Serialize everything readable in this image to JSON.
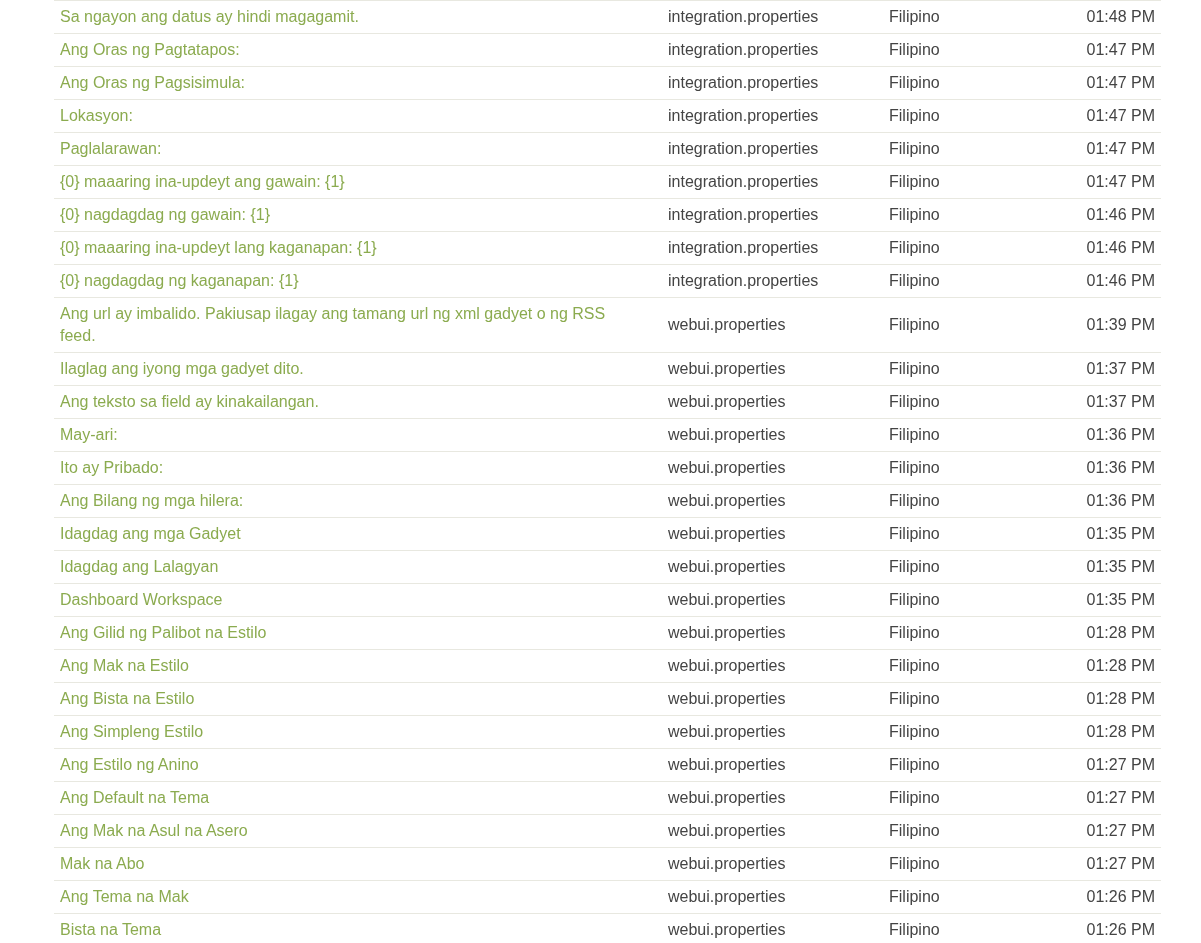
{
  "rows": [
    {
      "message": "Sa ngayon ang datus ay hindi magagamit.",
      "file": "integration.properties",
      "language": "Filipino",
      "time": "01:48 PM"
    },
    {
      "message": "Ang Oras ng Pagtatapos:",
      "file": "integration.properties",
      "language": "Filipino",
      "time": "01:47 PM"
    },
    {
      "message": "Ang Oras ng Pagsisimula:",
      "file": "integration.properties",
      "language": "Filipino",
      "time": "01:47 PM"
    },
    {
      "message": "Lokasyon:",
      "file": "integration.properties",
      "language": "Filipino",
      "time": "01:47 PM"
    },
    {
      "message": "Paglalarawan:",
      "file": "integration.properties",
      "language": "Filipino",
      "time": "01:47 PM"
    },
    {
      "message": "{0} maaaring ina-updeyt ang gawain: {1}",
      "file": "integration.properties",
      "language": "Filipino",
      "time": "01:47 PM"
    },
    {
      "message": "{0} nagdagdag ng gawain: {1}",
      "file": "integration.properties",
      "language": "Filipino",
      "time": "01:46 PM"
    },
    {
      "message": "{0} maaaring ina-updeyt lang kaganapan: {1}",
      "file": "integration.properties",
      "language": "Filipino",
      "time": "01:46 PM"
    },
    {
      "message": "{0} nagdagdag ng kaganapan: {1}",
      "file": "integration.properties",
      "language": "Filipino",
      "time": "01:46 PM"
    },
    {
      "message": "Ang url ay imbalido. Pakiusap ilagay ang tamang url ng xml gadyet o ng RSS feed.",
      "file": "webui.properties",
      "language": "Filipino",
      "time": "01:39 PM"
    },
    {
      "message": "Ilaglag ang iyong mga gadyet dito.",
      "file": "webui.properties",
      "language": "Filipino",
      "time": "01:37 PM"
    },
    {
      "message": "Ang teksto sa field ay kinakailangan.",
      "file": "webui.properties",
      "language": "Filipino",
      "time": "01:37 PM"
    },
    {
      "message": "May-ari:",
      "file": "webui.properties",
      "language": "Filipino",
      "time": "01:36 PM"
    },
    {
      "message": "Ito ay Pribado:",
      "file": "webui.properties",
      "language": "Filipino",
      "time": "01:36 PM"
    },
    {
      "message": "Ang Bilang ng mga hilera:",
      "file": "webui.properties",
      "language": "Filipino",
      "time": "01:36 PM"
    },
    {
      "message": "Idagdag ang mga Gadyet",
      "file": "webui.properties",
      "language": "Filipino",
      "time": "01:35 PM"
    },
    {
      "message": "Idagdag ang Lalagyan",
      "file": "webui.properties",
      "language": "Filipino",
      "time": "01:35 PM"
    },
    {
      "message": "Dashboard Workspace",
      "file": "webui.properties",
      "language": "Filipino",
      "time": "01:35 PM"
    },
    {
      "message": "Ang Gilid ng Palibot na Estilo",
      "file": "webui.properties",
      "language": "Filipino",
      "time": "01:28 PM"
    },
    {
      "message": "Ang Mak na Estilo",
      "file": "webui.properties",
      "language": "Filipino",
      "time": "01:28 PM"
    },
    {
      "message": "Ang Bista na Estilo",
      "file": "webui.properties",
      "language": "Filipino",
      "time": "01:28 PM"
    },
    {
      "message": "Ang Simpleng Estilo",
      "file": "webui.properties",
      "language": "Filipino",
      "time": "01:28 PM"
    },
    {
      "message": "Ang Estilo ng Anino",
      "file": "webui.properties",
      "language": "Filipino",
      "time": "01:27 PM"
    },
    {
      "message": "Ang Default na Tema",
      "file": "webui.properties",
      "language": "Filipino",
      "time": "01:27 PM"
    },
    {
      "message": "Ang Mak na Asul na Asero",
      "file": "webui.properties",
      "language": "Filipino",
      "time": "01:27 PM"
    },
    {
      "message": "Mak na Abo",
      "file": "webui.properties",
      "language": "Filipino",
      "time": "01:27 PM"
    },
    {
      "message": "Ang Tema na Mak",
      "file": "webui.properties",
      "language": "Filipino",
      "time": "01:26 PM"
    },
    {
      "message": "Bista na Tema",
      "file": "webui.properties",
      "language": "Filipino",
      "time": "01:26 PM"
    }
  ]
}
